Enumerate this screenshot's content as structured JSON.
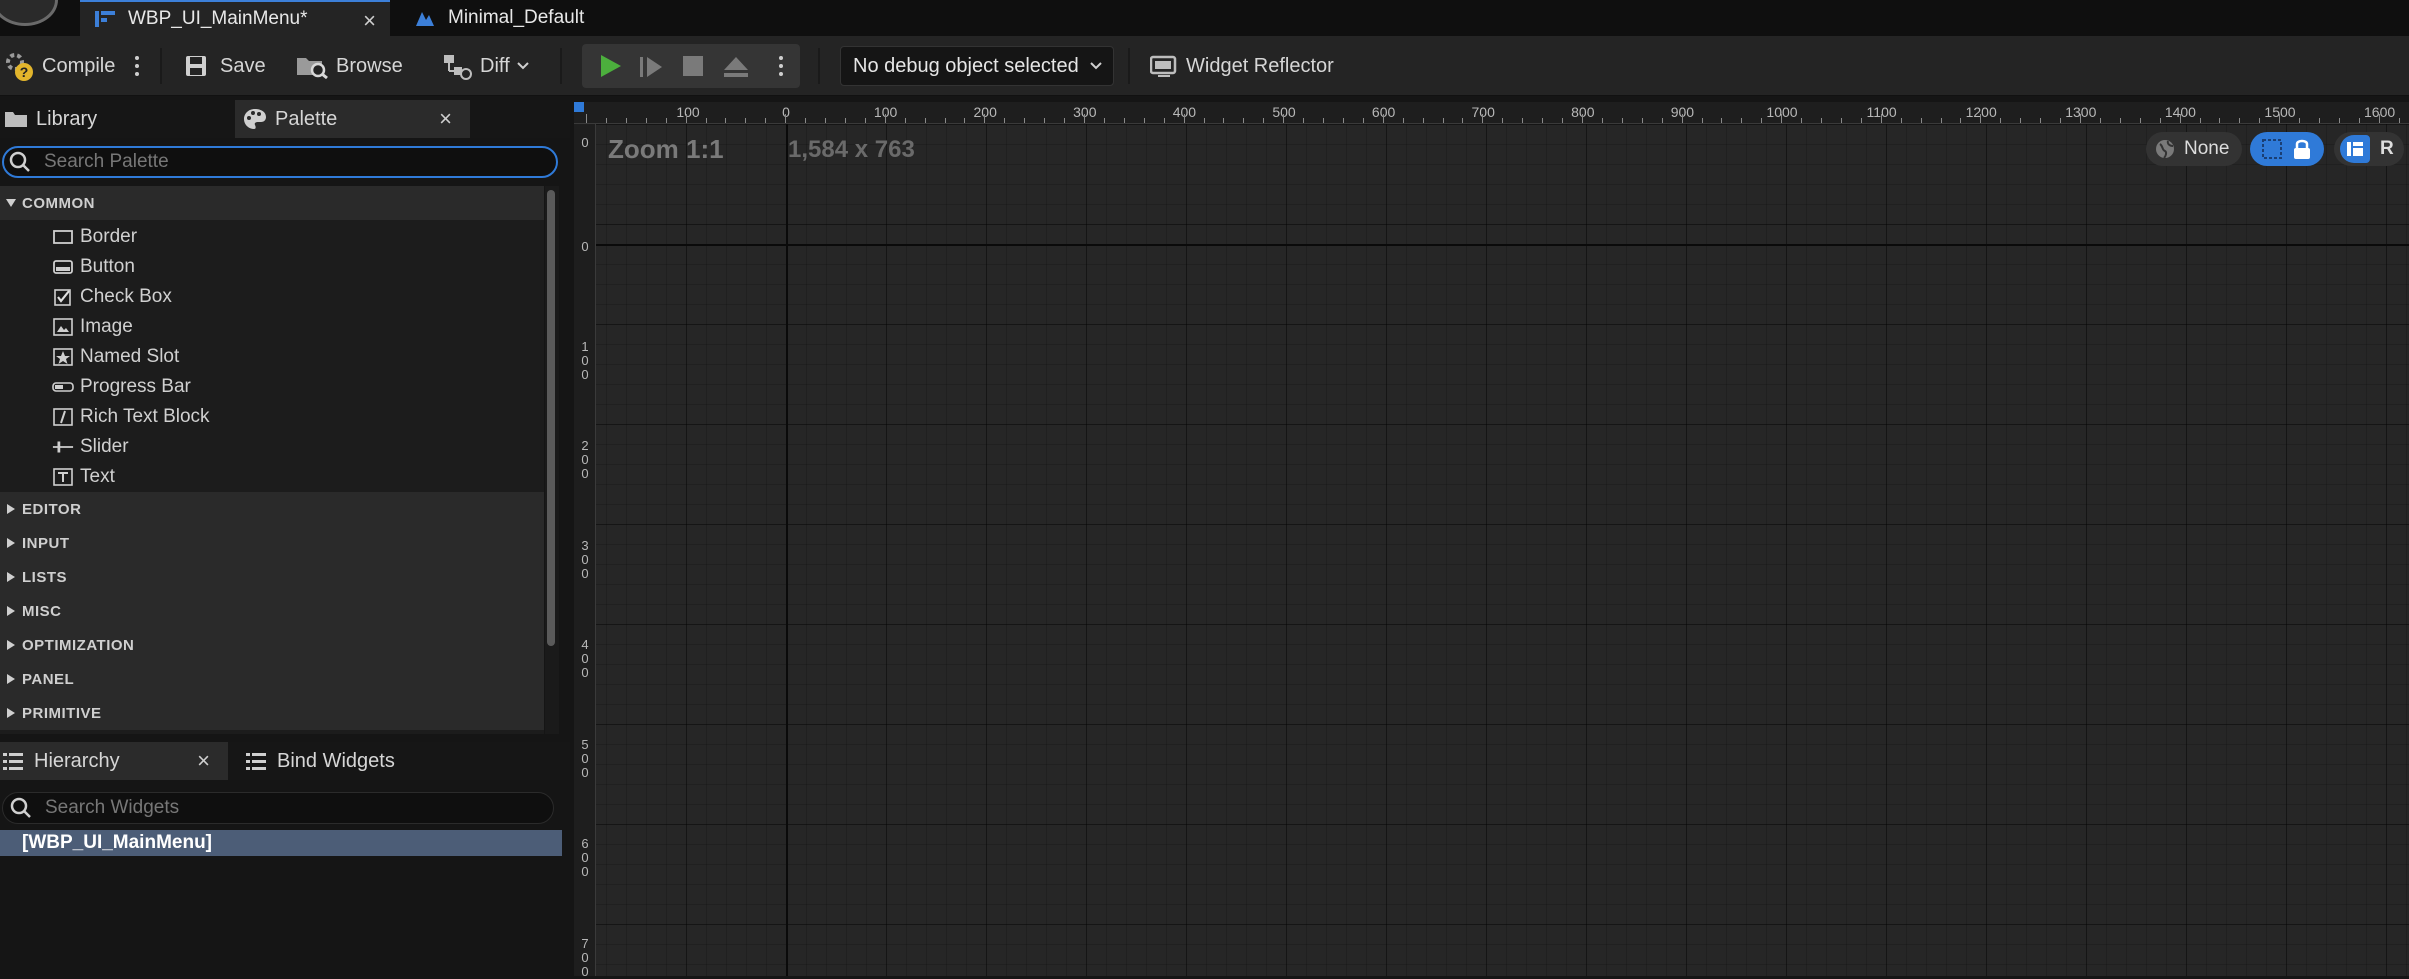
{
  "tabs": [
    {
      "title": "WBP_UI_MainMenu*",
      "close": "×"
    },
    {
      "title": "Minimal_Default"
    }
  ],
  "toolbar": {
    "compile": "Compile",
    "save": "Save",
    "browse": "Browse",
    "diff": "Diff",
    "debug_object": "No debug object selected",
    "widget_reflector": "Widget Reflector"
  },
  "palette": {
    "tabs": {
      "library": "Library",
      "palette": "Palette",
      "close": "×"
    },
    "search_placeholder": "Search Palette",
    "expanded_category": "COMMON",
    "items": [
      {
        "label": "Border",
        "icon": "border-icon"
      },
      {
        "label": "Button",
        "icon": "button-icon"
      },
      {
        "label": "Check Box",
        "icon": "checkbox-icon"
      },
      {
        "label": "Image",
        "icon": "image-icon"
      },
      {
        "label": "Named Slot",
        "icon": "named-slot-icon"
      },
      {
        "label": "Progress Bar",
        "icon": "progress-bar-icon"
      },
      {
        "label": "Rich Text Block",
        "icon": "rich-text-icon"
      },
      {
        "label": "Slider",
        "icon": "slider-icon"
      },
      {
        "label": "Text",
        "icon": "text-icon"
      }
    ],
    "collapsed_categories": [
      "EDITOR",
      "INPUT",
      "LISTS",
      "MISC",
      "OPTIMIZATION",
      "PANEL",
      "PRIMITIVE"
    ]
  },
  "hierarchy": {
    "tabs": {
      "hierarchy": "Hierarchy",
      "close": "×",
      "bind": "Bind Widgets"
    },
    "search_placeholder": "Search Widgets",
    "root": "[WBP_UI_MainMenu]"
  },
  "designer": {
    "zoom": "Zoom 1:1",
    "size": "1,584 x 763",
    "localization": "None",
    "r_button": "R",
    "ruler_top": [
      "100",
      "0",
      "100",
      "200",
      "300",
      "400",
      "500",
      "600",
      "700",
      "800",
      "900",
      "1000",
      "1100",
      "1200",
      "1300",
      "1400",
      "1500",
      "1600"
    ],
    "ruler_left": [
      "0",
      "0",
      "100",
      "200",
      "300",
      "400",
      "500",
      "600",
      "700"
    ]
  },
  "colors": {
    "accent": "#2f7ad8",
    "play_green": "#4caf3d",
    "selection": "#4c5d77"
  }
}
